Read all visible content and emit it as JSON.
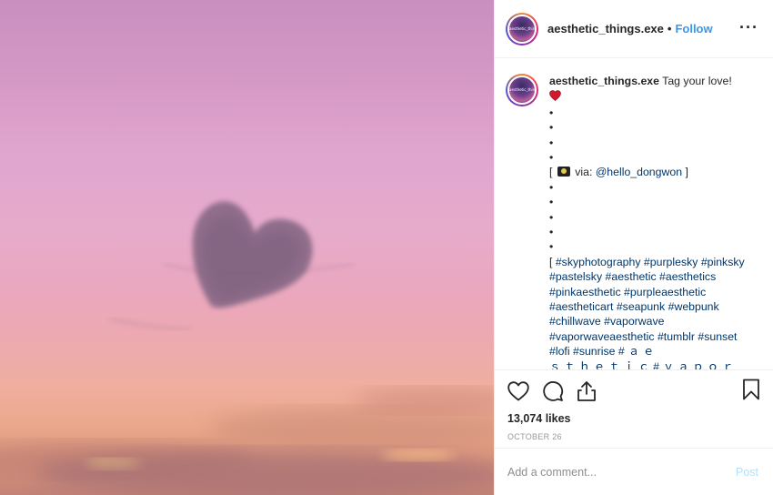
{
  "post": {
    "account": {
      "username": "aesthetic_things.exe",
      "avatar_text": "aesthetic_things.exe",
      "follow_label": "Follow",
      "separator": "•"
    },
    "menu_icon": "more-options-icon",
    "caption": {
      "username": "aesthetic_things.exe",
      "text": " Tag your love!",
      "emoji": "❤️",
      "bullet": "•",
      "via_prefix": "[ ",
      "via_label": "via: ",
      "via_handle": "@hello_dongwon",
      "via_suffix": " ]",
      "hashtags_open": "[ ",
      "hashtags": [
        "#skyphotography",
        "#purplesky",
        "#pinksky",
        "#pastelsky",
        "#aesthetic",
        "#aesthetics",
        "#pinkaesthetic",
        "#purpleaesthetic",
        "#aestheticart",
        "#seapunk",
        "#webpunk",
        "#chillwave",
        "#vaporwave",
        "#vaporwaveaesthetic",
        "#tumblr",
        "#sunset",
        "#lofi",
        "#sunrise"
      ],
      "wide_hashtag": "#ａｅ",
      "cut_line": "ｓｔｈｅｔｉｃ#ｖａｐｏｒｗａｖｅ"
    },
    "actions": {
      "like_icon": "heart-outline-icon",
      "comment_icon": "comment-bubble-icon",
      "share_icon": "share-upload-icon",
      "save_icon": "bookmark-icon",
      "likes": "13,074 likes",
      "date": "OCTOBER 26"
    },
    "comment": {
      "placeholder": "Add a comment...",
      "post_label": "Post"
    },
    "colors": {
      "link": "#3897f0",
      "hashtag": "#003569",
      "post_disabled": "#b2dffc",
      "sky_top": "#c98fbf",
      "sky_bottom": "#eba88b"
    }
  }
}
